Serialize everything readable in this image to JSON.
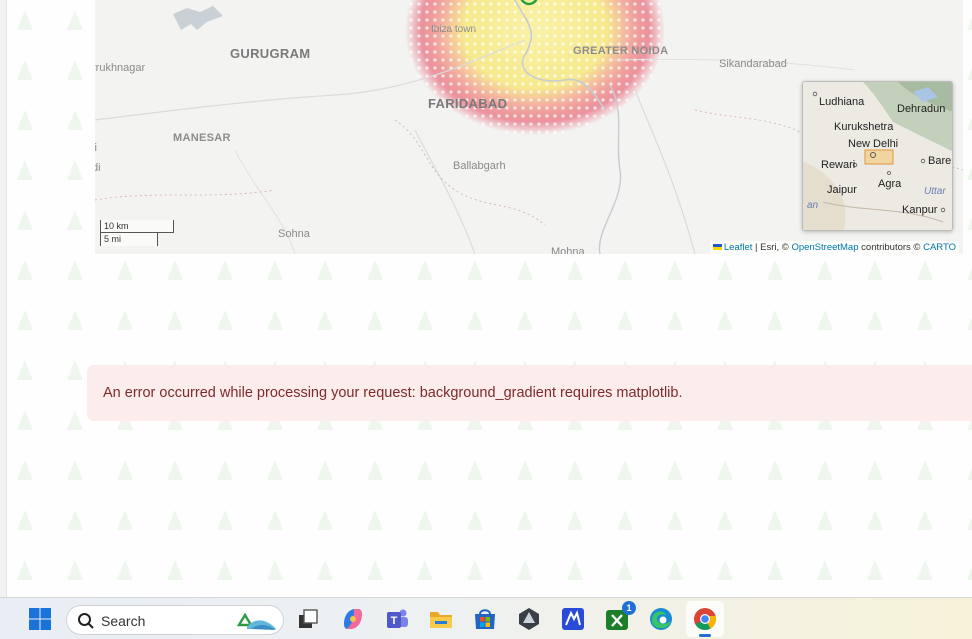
{
  "map": {
    "labels": {
      "gurugram": "GURUGRAM",
      "farrukhnagar": "rrukhnagar",
      "manesar": "MANESAR",
      "faridabad": "FARIDABAD",
      "greater_noida": "GREATER NOIDA",
      "sikandarabad": "Sikandarabad",
      "ibiza_town": "Ibiza town",
      "ballabgarh": "Ballabgarh",
      "sohna": "Sohna",
      "mohna": "Mohna",
      "left_cut_1": "li",
      "left_cut_2": "di"
    },
    "scale": {
      "metric": "10 km",
      "imperial": "5 mi"
    },
    "minimap": {
      "labels": {
        "ludhiana": "Ludhiana",
        "dehradun": "Dehradun",
        "kurukshetra": "Kurukshetra",
        "new_delhi": "New Delhi",
        "rewari": "Rewari",
        "bareilly": "Bare",
        "jaipur": "Jaipur",
        "agra": "Agra",
        "uttar": "Uttar",
        "kanpur": "Kanpur",
        "an": "an"
      }
    },
    "attribution": {
      "leaflet": "Leaflet",
      "esri": " | Esri, © ",
      "osm": "OpenStreetMap",
      "contributors": " contributors © ",
      "carto": "CARTO"
    },
    "colors": {
      "heat_core": "#f7ee9a",
      "heat_edge": "#e8475e",
      "background": "#f3f3f1"
    }
  },
  "error": {
    "message": "An error occurred while processing your request: background_gradient requires matplotlib."
  },
  "taskbar": {
    "search_placeholder": "Search",
    "xbox_badge": "1",
    "icons": [
      "windows-start-icon",
      "search-icon",
      "recycle-icon",
      "task-view-icon",
      "copilot-icon",
      "teams-icon",
      "file-explorer-icon",
      "store-icon",
      "shield-app-icon",
      "vscode-icon",
      "xbox-icon",
      "edge-icon",
      "chrome-icon"
    ]
  }
}
